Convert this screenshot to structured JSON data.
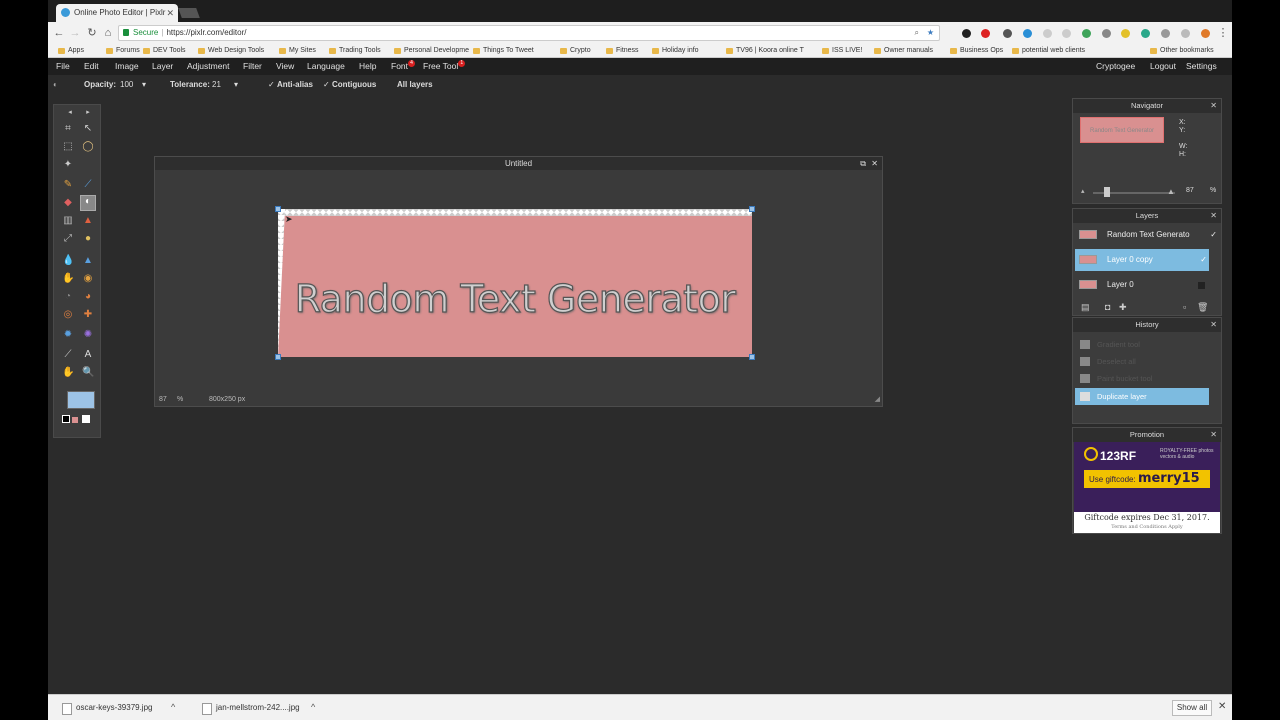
{
  "browser": {
    "tab_title": "Online Photo Editor | Pixlr",
    "address_secure": "Secure",
    "url": "https://pixlr.com/editor/",
    "bookmarks": [
      "Apps",
      "Forums",
      "DEV Tools",
      "Web Design Tools",
      "My Sites",
      "Trading Tools",
      "Personal Developme",
      "Things To Tweet",
      "Crypto",
      "Fitness",
      "Holiday info",
      "TV96 | Koora online T",
      "ISS LIVE!",
      "Owner manuals",
      "Business Ops",
      "potential web clients"
    ],
    "other_bookmarks": "Other bookmarks"
  },
  "menu": {
    "items": [
      "File",
      "Edit",
      "Image",
      "Layer",
      "Adjustment",
      "Filter",
      "View",
      "Language",
      "Help",
      "Font",
      "Free Tool"
    ],
    "right": [
      "Cryptogee",
      "Logout",
      "Settings"
    ],
    "badge_font": "4",
    "badge_freetool": "1"
  },
  "options": {
    "opacity_label": "Opacity:",
    "opacity_value": "100",
    "tolerance_label": "Tolerance:",
    "tolerance_value": "21",
    "antialias": "Anti-alias",
    "contiguous": "Contiguous",
    "all_layers": "All layers"
  },
  "document": {
    "title": "Untitled",
    "zoom": "87",
    "zoom_unit": "%",
    "dimensions": "800x250 px",
    "canvas_text": "Random Text Generator",
    "canvas_color": "#d99090"
  },
  "navigator": {
    "title": "Navigator",
    "x_label": "X:",
    "y_label": "Y:",
    "w_label": "W:",
    "h_label": "H:",
    "zoom": "87",
    "zoom_unit": "%",
    "thumb_text": "Random Text Generator"
  },
  "layers": {
    "title": "Layers",
    "items": [
      {
        "name": "Random Text Generato",
        "selected": false
      },
      {
        "name": "Layer 0 copy",
        "selected": true
      },
      {
        "name": "Layer 0",
        "selected": false
      }
    ]
  },
  "history": {
    "title": "History",
    "items": [
      "Gradient tool",
      "Deselect all",
      "Paint bucket tool",
      "Duplicate layer"
    ]
  },
  "promotion": {
    "title": "Promotion",
    "brand": "123RF",
    "tagline": "ROYALTY-FREE photos vectors & audio",
    "code_label": "Use giftcode:",
    "code": "merry15",
    "expiry": "Giftcode expires Dec 31, 2017.",
    "terms": "Terms and Conditions Apply"
  },
  "downloads": {
    "items": [
      "oscar-keys-39379.jpg",
      "jan-mellstrom-242....jpg"
    ],
    "show_all": "Show all"
  },
  "colors": {
    "accent": "#7dbbe0",
    "handle": "#9dc3e6"
  }
}
